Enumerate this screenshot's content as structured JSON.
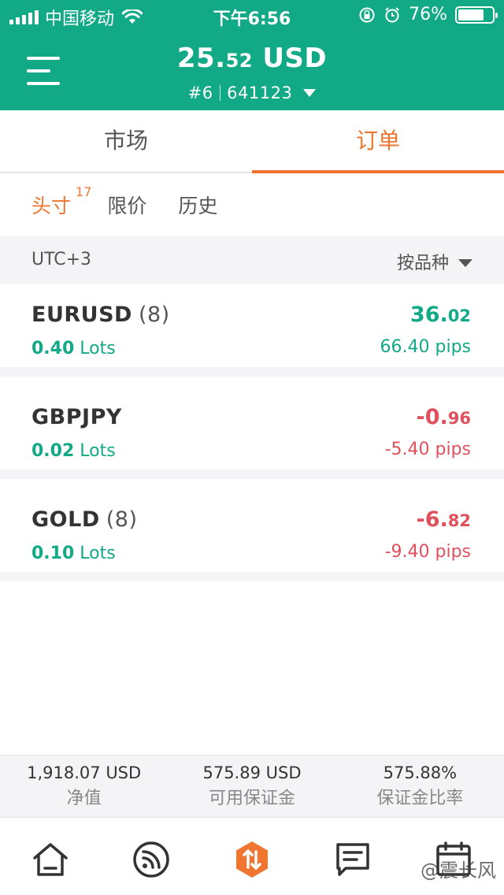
{
  "status_bar": {
    "carrier": "中国移动",
    "time": "下午6:56",
    "battery_text": "76%",
    "battery_level": 0.76
  },
  "header": {
    "balance_main": "25.",
    "balance_decimals": "52",
    "balance_currency": " USD",
    "account_index": "#6",
    "account_number": "641123"
  },
  "tabs": {
    "market": "市场",
    "orders": "订单"
  },
  "subtabs": {
    "positions": "头寸",
    "positions_count": "17",
    "pending": "限价",
    "history": "历史"
  },
  "filter": {
    "timezone": "UTC+3",
    "sort_label": "按品种"
  },
  "positions": [
    {
      "symbol": "EURUSD",
      "count": "(8)",
      "lots_value": "0.40",
      "lots_unit": " Lots",
      "pl_main": "36.",
      "pl_decimals": "02",
      "pips": "66.40 pips",
      "direction": "positive"
    },
    {
      "symbol": "GBPJPY",
      "count": "",
      "lots_value": "0.02",
      "lots_unit": " Lots",
      "pl_main": "-0.",
      "pl_decimals": "96",
      "pips": "-5.40 pips",
      "direction": "negative"
    },
    {
      "symbol": "GOLD",
      "count": "(8)",
      "lots_value": "0.10",
      "lots_unit": " Lots",
      "pl_main": "-6.",
      "pl_decimals": "82",
      "pips": "-9.40 pips",
      "direction": "negative"
    }
  ],
  "summary": {
    "equity_value": "1,918.07 USD",
    "equity_label": "净值",
    "free_margin_value": "575.89 USD",
    "free_margin_label": "可用保证金",
    "margin_level_value": "575.88%",
    "margin_level_label": "保证金比率"
  },
  "nav": {
    "items": [
      "home-icon",
      "feed-icon",
      "trade-icon",
      "news-icon",
      "calendar-icon"
    ]
  },
  "watermark": "@震长风",
  "colors": {
    "brand_green": "#12a986",
    "accent_orange": "#ef7531",
    "loss_red": "#e2505d"
  }
}
